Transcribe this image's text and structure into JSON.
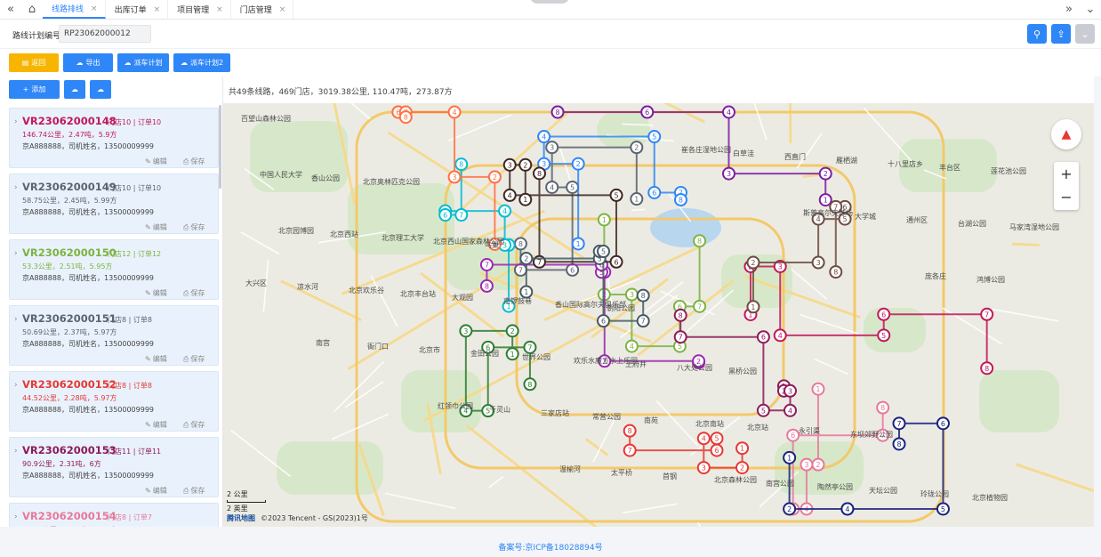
{
  "tabs": [
    {
      "label": "线路排线",
      "active": true
    },
    {
      "label": "出库订单",
      "active": false
    },
    {
      "label": "项目管理",
      "active": false
    },
    {
      "label": "门店管理",
      "active": false
    }
  ],
  "icons": {
    "collapse": "«",
    "home": "⌂",
    "close": "×",
    "expand": "»",
    "dropdown": "⌄",
    "search": "⚲",
    "export": "⇪",
    "more": "⌄",
    "chevron": "›",
    "plus": "+",
    "cloud": "☁",
    "edit": "✎",
    "save": "⎙",
    "zoom_in": "+",
    "zoom_out": "−"
  },
  "filter": {
    "label": "路线计划编号",
    "value": "RP23062000012"
  },
  "colors": {
    "primary": "#2f86f6",
    "warning": "#f7b500"
  },
  "toolbar": {
    "back_label": "返回",
    "export_label": "导出",
    "dispatch_label": "派车计划",
    "dispatch2_label": "派车计划2"
  },
  "left_panel": {
    "add_label": "添加"
  },
  "routes": [
    {
      "id": "VR23062000148",
      "meta": "门店10 | 订单10",
      "line2": "146.74公里，2.47吨，5.9方",
      "line3": "京A888888，司机姓名，13500009999",
      "color": "#c2185b"
    },
    {
      "id": "VR23062000149",
      "meta": "门店10 | 订单10",
      "line2": "58.75公里，2.45吨，5.99方",
      "line3": "京A888888，司机姓名，13500009999",
      "color": "#5b6472"
    },
    {
      "id": "VR23062000150",
      "meta": "门店12 | 订单12",
      "line2": "53.3公里，2.51吨，5.95方",
      "line3": "京A888888，司机姓名，13500009999",
      "color": "#7cb342"
    },
    {
      "id": "VR23062000151",
      "meta": "门店8 | 订单8",
      "line2": "50.69公里，2.37吨，5.97方",
      "line3": "京A888888，司机姓名，13500009999",
      "color": "#5b6472"
    },
    {
      "id": "VR23062000152",
      "meta": "门店8 | 订单8",
      "line2": "44.52公里，2.28吨，5.97方",
      "line3": "京A888888，司机姓名，13500009999",
      "color": "#e53935"
    },
    {
      "id": "VR23062000153",
      "meta": "门店11 | 订单11",
      "line2": "90.9公里，2.31吨，6方",
      "line3": "京A888888，司机姓名，13500009999",
      "color": "#8e1a5b"
    },
    {
      "id": "VR23062000154",
      "meta": "门店8 | 订单7",
      "line2": "60.12公里，2.22吨，5.47方",
      "line3": "",
      "color": "#e8789a"
    }
  ],
  "card_actions": {
    "edit": "编辑",
    "save": "保存"
  },
  "summary": "共49条线路，469门店，3019.38公里, 110.47吨，273.87方",
  "map": {
    "places": [
      "百望山森林公园",
      "北京奥林匹克公园",
      "鸟巢",
      "朝阳公园",
      "黑桥公园",
      "东坝郊野公园",
      "北京植物园",
      "香山公园",
      "北京西山国家森林公园",
      "香山国际高尔夫俱乐部",
      "八大处公园",
      "永引渠",
      "玲珑公园",
      "中国人民大学",
      "北京理工大学",
      "南锣鼓巷",
      "王府井",
      "北京站",
      "天坛公园",
      "莲花池公园",
      "北京西站",
      "大观园",
      "欢乐水魔方水上乐园",
      "北京南站",
      "陶然亭公园",
      "丰台区",
      "北京园博园",
      "北京丰台站",
      "世界公园",
      "南苑",
      "南宫公园",
      "十八里店乡",
      "马家湾湿地公园",
      "北京欢乐谷",
      "金田公园",
      "常营公园",
      "北京森林公园",
      "雁栖湖",
      "台湖公园",
      "凉水河",
      "北京市",
      "三家店站",
      "首钢",
      "西直门",
      "通州区",
      "大兴区",
      "衙门口",
      "千灵山",
      "太平桥",
      "白草洼",
      "大学城",
      "鸿博公园",
      "南宫",
      "红领巾公园",
      "温榆河",
      "崔各庄湿地公园",
      "斯普高尔夫球场",
      "庞各庄"
    ],
    "scale_km": "2 公里",
    "scale_mi": "2 英里",
    "logo": "腾讯地图",
    "copyright": "©2023 Tencent - GS(2023)1号"
  },
  "footer": "备案号:京ICP备18028894号"
}
